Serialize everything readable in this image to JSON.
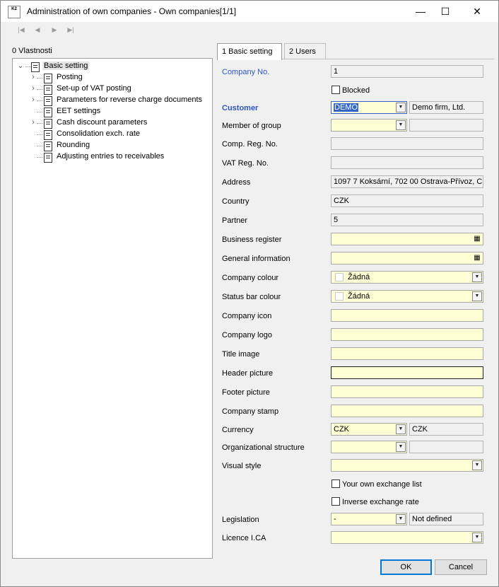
{
  "window": {
    "title": "Administration of own companies - Own companies[1/1]",
    "icon_text": "K2",
    "controls": [
      "minimize-icon",
      "maximize-icon",
      "close-icon"
    ]
  },
  "toolbar": {
    "buttons": [
      "first-record-icon",
      "previous-record-icon",
      "next-record-icon",
      "last-record-icon"
    ]
  },
  "left_panel": {
    "caption": "0 Vlastnosti",
    "root": "Basic setting",
    "items": [
      {
        "label": "Posting",
        "expandable": true
      },
      {
        "label": "Set-up of VAT posting",
        "expandable": true
      },
      {
        "label": "Parameters for reverse charge documents",
        "expandable": true
      },
      {
        "label": "EET settings",
        "expandable": false
      },
      {
        "label": "Cash discount parameters",
        "expandable": true
      },
      {
        "label": "Consolidation exch. rate",
        "expandable": false
      },
      {
        "label": "Rounding",
        "expandable": false
      },
      {
        "label": "Adjusting entries to receivables",
        "expandable": false
      }
    ]
  },
  "tabs": [
    {
      "label": "1 Basic setting",
      "active": true
    },
    {
      "label": "2 Users",
      "active": false
    }
  ],
  "form": {
    "company_no": {
      "label": "Company No.",
      "value": "1"
    },
    "blocked": {
      "label": "Blocked",
      "checked": false
    },
    "customer": {
      "label": "Customer",
      "value": "DEMO",
      "name": "Demo firm, Ltd."
    },
    "member_of_group": {
      "label": "Member of group",
      "value": "",
      "name": ""
    },
    "comp_reg_no": {
      "label": "Comp. Reg. No.",
      "value": ""
    },
    "vat_reg_no": {
      "label": "VAT Reg. No.",
      "value": ""
    },
    "address": {
      "label": "Address",
      "value": "1097 7  Koksární, 702 00  Ostrava-Přívoz, C"
    },
    "country": {
      "label": "Country",
      "value": "CZK"
    },
    "partner": {
      "label": "Partner",
      "value": "5"
    },
    "business_register": {
      "label": "Business register",
      "value": ""
    },
    "general_information": {
      "label": "General information",
      "value": ""
    },
    "company_colour": {
      "label": "Company colour",
      "value": "Žádná"
    },
    "status_bar_colour": {
      "label": "Status bar colour",
      "value": "Žádná"
    },
    "company_icon": {
      "label": "Company icon",
      "value": ""
    },
    "company_logo": {
      "label": "Company logo",
      "value": ""
    },
    "title_image": {
      "label": "Title image",
      "value": ""
    },
    "header_picture": {
      "label": "Header picture",
      "value": ""
    },
    "footer_picture": {
      "label": "Footer picture",
      "value": ""
    },
    "company_stamp": {
      "label": "Company stamp",
      "value": ""
    },
    "currency": {
      "label": "Currency",
      "value": "CZK",
      "name": "CZK"
    },
    "organizational_structure": {
      "label": "Organizational structure",
      "value": "",
      "name": ""
    },
    "visual_style": {
      "label": "Visual style",
      "value": ""
    },
    "own_exchange_list": {
      "label": "Your own exchange list",
      "checked": false
    },
    "inverse_exchange_rate": {
      "label": "Inverse exchange rate",
      "checked": false
    },
    "legislation": {
      "label": "Legislation",
      "value": "-",
      "name": "Not defined"
    },
    "licence_ica": {
      "label": "Licence I.CA",
      "value": ""
    }
  },
  "buttons": {
    "ok": "OK",
    "cancel": "Cancel"
  },
  "colors": {
    "accent_label": "#2a56c6",
    "field_yellow": "#ffffd6",
    "selection": "#3366cc"
  }
}
